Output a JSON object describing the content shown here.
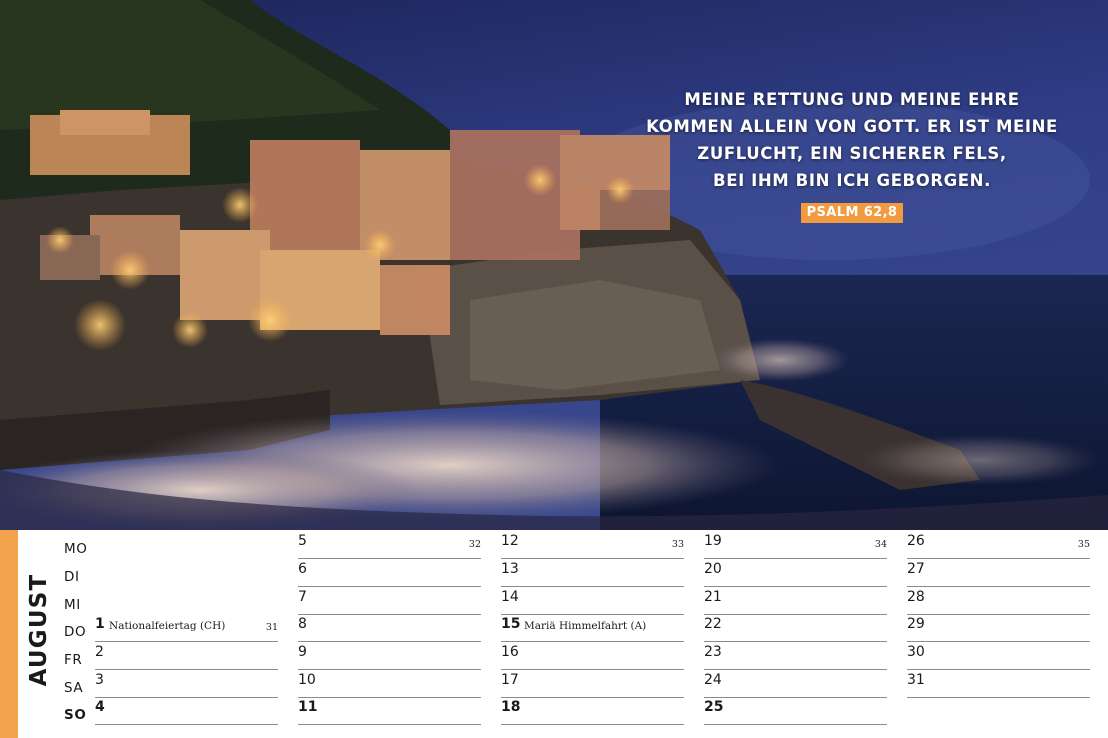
{
  "quote": {
    "lines": [
      "MEINE RETTUNG UND MEINE EHRE",
      "KOMMEN ALLEIN VON GOTT. ER IST MEINE",
      "ZUFLUCHT, EIN SICHERER FELS,",
      "BEI IHM BIN ICH GEBORGEN."
    ],
    "reference": "PSALM 62,8"
  },
  "month": "AUGUST",
  "weekdays": [
    "MO",
    "DI",
    "MI",
    "DO",
    "FR",
    "SA",
    "SO"
  ],
  "weeks": [
    {
      "week_number": "31",
      "days": [
        {
          "weekday": "DO",
          "day": "1",
          "holiday": "Nationalfeiertag (CH)"
        },
        {
          "weekday": "FR",
          "day": "2"
        },
        {
          "weekday": "SA",
          "day": "3"
        },
        {
          "weekday": "SO",
          "day": "4"
        }
      ]
    },
    {
      "week_number": "32",
      "days": [
        {
          "weekday": "MO",
          "day": "5"
        },
        {
          "weekday": "DI",
          "day": "6"
        },
        {
          "weekday": "MI",
          "day": "7"
        },
        {
          "weekday": "DO",
          "day": "8"
        },
        {
          "weekday": "FR",
          "day": "9"
        },
        {
          "weekday": "SA",
          "day": "10"
        },
        {
          "weekday": "SO",
          "day": "11"
        }
      ]
    },
    {
      "week_number": "33",
      "days": [
        {
          "weekday": "MO",
          "day": "12"
        },
        {
          "weekday": "DI",
          "day": "13"
        },
        {
          "weekday": "MI",
          "day": "14"
        },
        {
          "weekday": "DO",
          "day": "15",
          "holiday": "Mariä Himmelfahrt (A)"
        },
        {
          "weekday": "FR",
          "day": "16"
        },
        {
          "weekday": "SA",
          "day": "17"
        },
        {
          "weekday": "SO",
          "day": "18"
        }
      ]
    },
    {
      "week_number": "34",
      "days": [
        {
          "weekday": "MO",
          "day": "19"
        },
        {
          "weekday": "DI",
          "day": "20"
        },
        {
          "weekday": "MI",
          "day": "21"
        },
        {
          "weekday": "DO",
          "day": "22"
        },
        {
          "weekday": "FR",
          "day": "23"
        },
        {
          "weekday": "SA",
          "day": "24"
        },
        {
          "weekday": "SO",
          "day": "25"
        }
      ]
    },
    {
      "week_number": "35",
      "days": [
        {
          "weekday": "MO",
          "day": "26"
        },
        {
          "weekday": "DI",
          "day": "27"
        },
        {
          "weekday": "MI",
          "day": "28"
        },
        {
          "weekday": "DO",
          "day": "29"
        },
        {
          "weekday": "FR",
          "day": "30"
        },
        {
          "weekday": "SA",
          "day": "31"
        }
      ]
    }
  ],
  "colors": {
    "accent": "#f3a24d",
    "reference_badge": "#f19a3e",
    "text": "#1a1a1a",
    "rule": "#8a8a8a"
  }
}
